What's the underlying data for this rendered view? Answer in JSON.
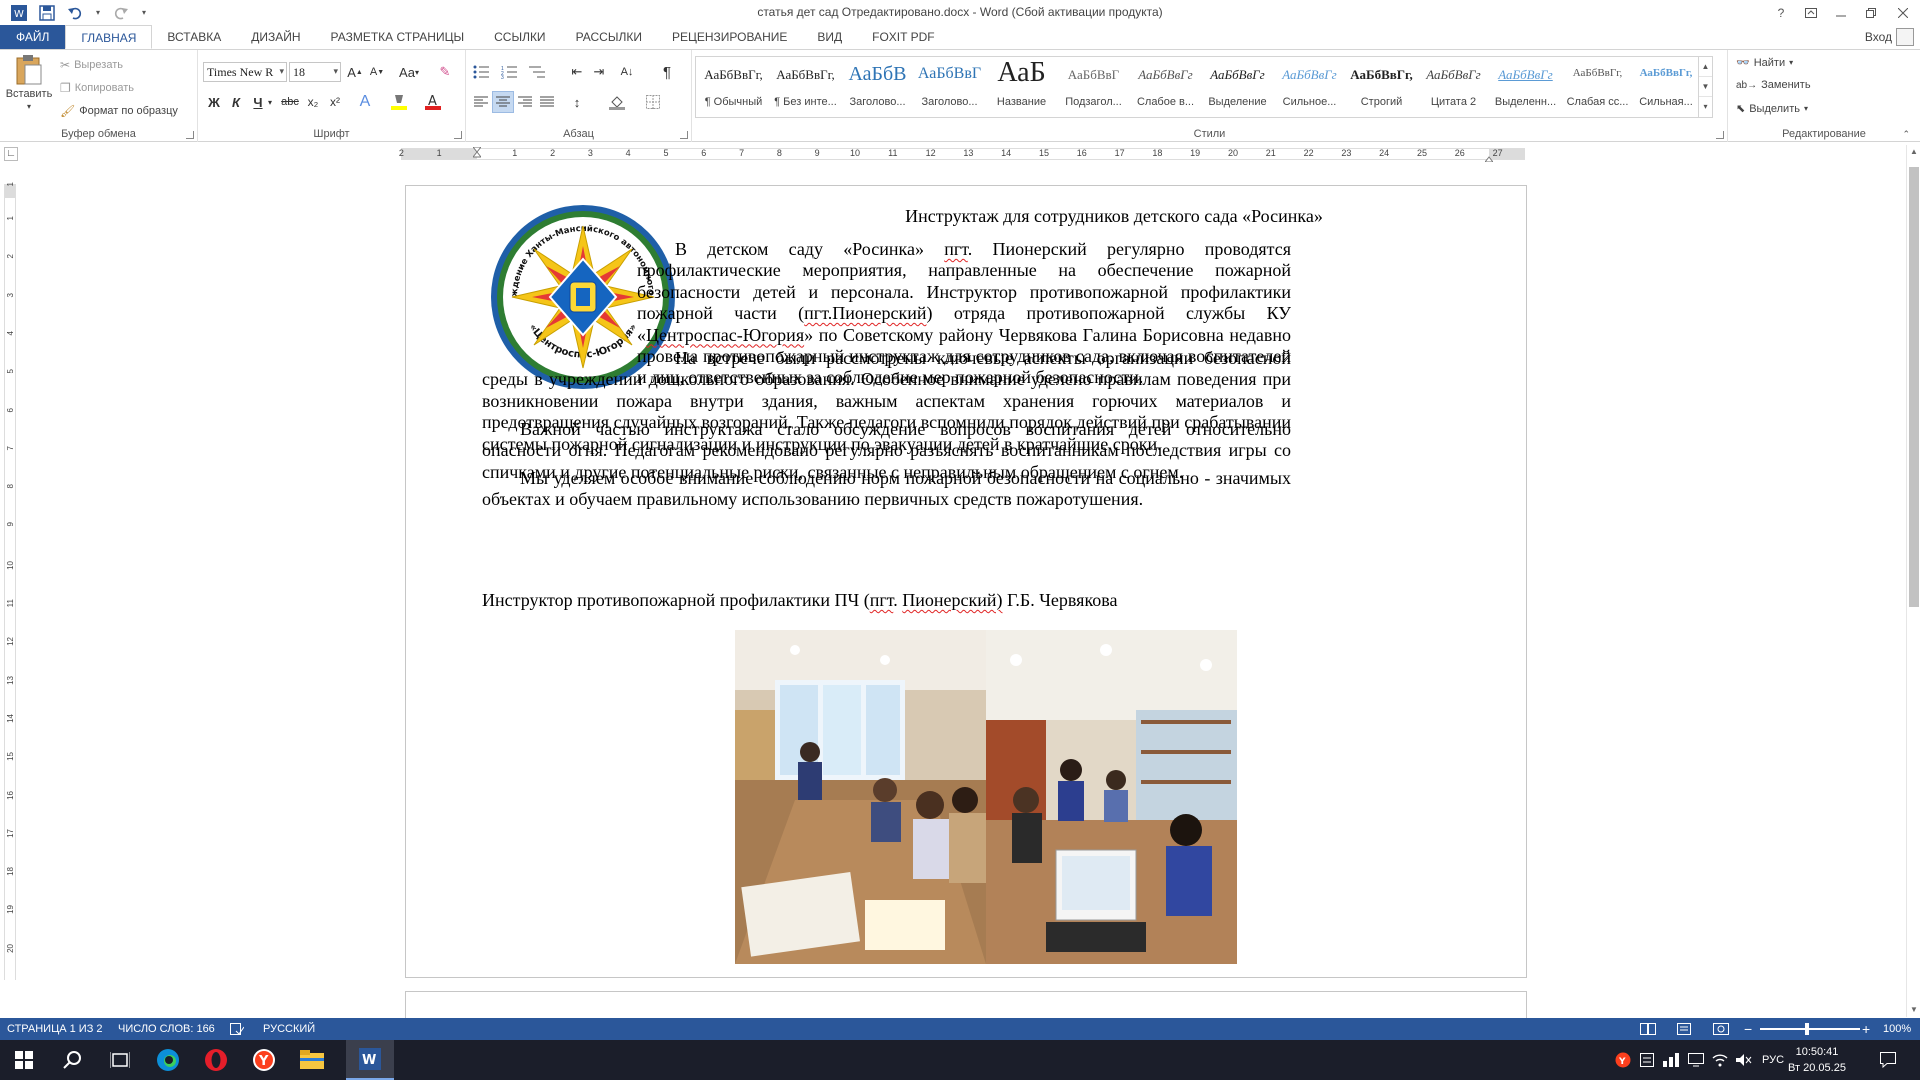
{
  "window": {
    "title": "статья дет сад Отредактировано.docx - Word (Сбой активации продукта)",
    "help": "?",
    "login": "Вход"
  },
  "tabs": [
    "ФАЙЛ",
    "ГЛАВНАЯ",
    "ВСТАВКА",
    "ДИЗАЙН",
    "РАЗМЕТКА СТРАНИЦЫ",
    "ССЫЛКИ",
    "РАССЫЛКИ",
    "РЕЦЕНЗИРОВАНИЕ",
    "ВИД",
    "FOXIT PDF"
  ],
  "ribbon": {
    "clipboard": {
      "label": "Буфер обмена",
      "paste": "Вставить",
      "cut": "Вырезать",
      "copy": "Копировать",
      "format_painter": "Формат по образцу"
    },
    "font": {
      "label": "Шрифт",
      "font_name": "Times New R",
      "font_size": "18",
      "case": "Aa",
      "bold": "Ж",
      "italic": "К",
      "underline": "Ч",
      "strike": "abc",
      "sub": "x₂",
      "sup": "x²"
    },
    "paragraph": {
      "label": "Абзац",
      "pilcrow": "¶"
    },
    "styles": {
      "label": "Стили",
      "items": [
        {
          "preview": "АаБбВвГг,",
          "name": "¶ Обычный"
        },
        {
          "preview": "АаБбВвГг,",
          "name": "¶ Без инте..."
        },
        {
          "preview": "АаБбВ",
          "name": "Заголово..."
        },
        {
          "preview": "АаБбВвГ",
          "name": "Заголово..."
        },
        {
          "preview": "АаБ",
          "name": "Название"
        },
        {
          "preview": "АаБбВвГ",
          "name": "Подзагол..."
        },
        {
          "preview": "АаБбВвГг",
          "name": "Слабое в..."
        },
        {
          "preview": "АаБбВвГг",
          "name": "Выделение"
        },
        {
          "preview": "АаБбВвГг",
          "name": "Сильное..."
        },
        {
          "preview": "АаБбВвГг,",
          "name": "Строгий"
        },
        {
          "preview": "АаБбВвГг",
          "name": "Цитата 2"
        },
        {
          "preview": "АаБбВвГг",
          "name": "Выделенн..."
        },
        {
          "preview": "АаБбВвГг,",
          "name": "Слабая сс..."
        },
        {
          "preview": "АаБбВвГг,",
          "name": "Сильная..."
        }
      ]
    },
    "editing": {
      "label": "Редактирование",
      "find": "Найти",
      "replace": "Заменить",
      "select": "Выделить"
    }
  },
  "ruler": {
    "h_numbers": [
      "2",
      "1",
      "1",
      "2",
      "3",
      "4",
      "5",
      "6",
      "7",
      "8",
      "9",
      "10",
      "11",
      "12",
      "13",
      "14",
      "15",
      "16",
      "17",
      "18",
      "19",
      "20",
      "21",
      "22",
      "23",
      "24",
      "25",
      "26",
      "27"
    ],
    "v_numbers": [
      "1",
      "1",
      "2",
      "3",
      "4",
      "5",
      "6",
      "7",
      "8",
      "9",
      "10",
      "11",
      "12",
      "13",
      "14",
      "15",
      "16",
      "17",
      "18",
      "19",
      "20"
    ]
  },
  "document": {
    "title": "Инструктаж для сотрудников детского сада «Росинка»",
    "logo_text_top": "Казенное учреждение Ханты-Мансийского автономного округа - Югры",
    "logo_text_bottom": "«Центроспас-Югория»",
    "p1_a": "В детском саду «Росинка» ",
    "p1_pgt": "пгт",
    "p1_b": ". Пионерский регулярно проводятся профилактические мероприятия, направленные на обеспечение пожарной безопасности детей и персонала. Инструктор противопожарной профилактики пожарной части (",
    "p1_pgt2": "пгт.Пионерский",
    "p1_c": ") отряда противопожарной службы КУ «",
    "p1_cs": "Центроспас-Югория",
    "p1_d": "» по Советскому району Червякова Галина Борисовна недавно провела противопожарный инструктаж для сотрудников сада, включая воспитателей и лиц, ответственных за соблюдение мер пожарной безопасности.",
    "p2": "На встрече были рассмотрены ключевые аспекты организации безопасной среды в учреждении дошкольного образования. Особенное внимание уделено правилам поведения при возникновении пожара внутри здания, важным аспектам хранения горючих материалов и предотвращения случайных возгораний. Также педагоги вспомнили порядок действий при срабатывании системы пожарной сигнализации и инструкции по эвакуации детей в кратчайшие сроки.",
    "p3": "Важной частью инструктажа стало обсуждение вопросов воспитания детей относительно опасности огня. Педагогам рекомендовано регулярно разъяснять воспитанникам последствия игры со спичками и другие потенциальные риски, связанные с неправильным обращением с огнем.",
    "p4": "Мы уделяем особое внимание соблюдению норм пожарной безопасности на социально - значимых объектах и обучаем правильному использованию первичных средств пожаротушения.",
    "sig_a": "Инструктор противопожарной профилактики ПЧ (",
    "sig_pgt": "пгт",
    "sig_b": ". ",
    "sig_pion": "Пионерский)",
    "sig_c": "   Г.Б. Червякова"
  },
  "status": {
    "page": "СТРАНИЦА 1 ИЗ 2",
    "words": "ЧИСЛО СЛОВ: 166",
    "language": "РУССКИЙ",
    "zoom": "100%",
    "zoom_minus": "−",
    "zoom_plus": "+"
  },
  "taskbar": {
    "keyboard_lang": "РУС",
    "time": "10:50:41",
    "date": "Вт 20.05.25"
  },
  "colors": {
    "accent": "#2b579a",
    "taskbar": "#1b1e2a"
  }
}
